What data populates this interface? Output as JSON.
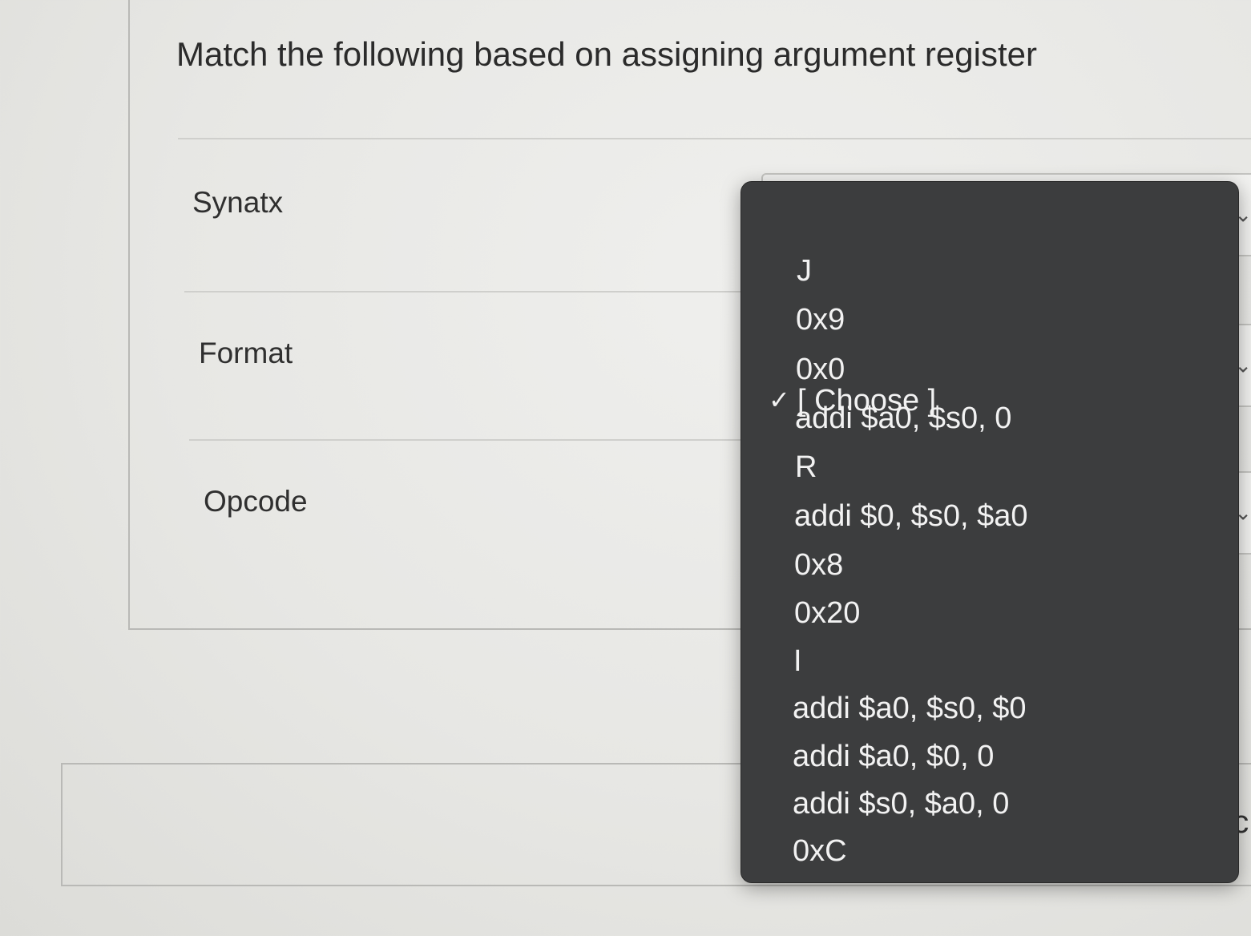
{
  "question": {
    "title": "Match the following based on assigning argument register"
  },
  "rows": [
    {
      "label": "Synatx"
    },
    {
      "label": "Format"
    },
    {
      "label": "Opcode"
    }
  ],
  "dropdown": {
    "selected": "[ Choose ]",
    "options": [
      "[ Choose ]",
      "J",
      "0x9",
      "0x0",
      "addi $a0, $s0, 0",
      "R",
      "addi $0, $s0, $a0",
      "0x8",
      "0x20",
      "I",
      "addi $a0, $s0, $0",
      "addi $a0, $0, 0",
      "addi $s0, $a0, 0",
      "0xC"
    ]
  },
  "footer": {
    "clipped_text": "ec"
  },
  "icons": {
    "check": "check-icon",
    "chevron": "chevron-down-icon"
  }
}
